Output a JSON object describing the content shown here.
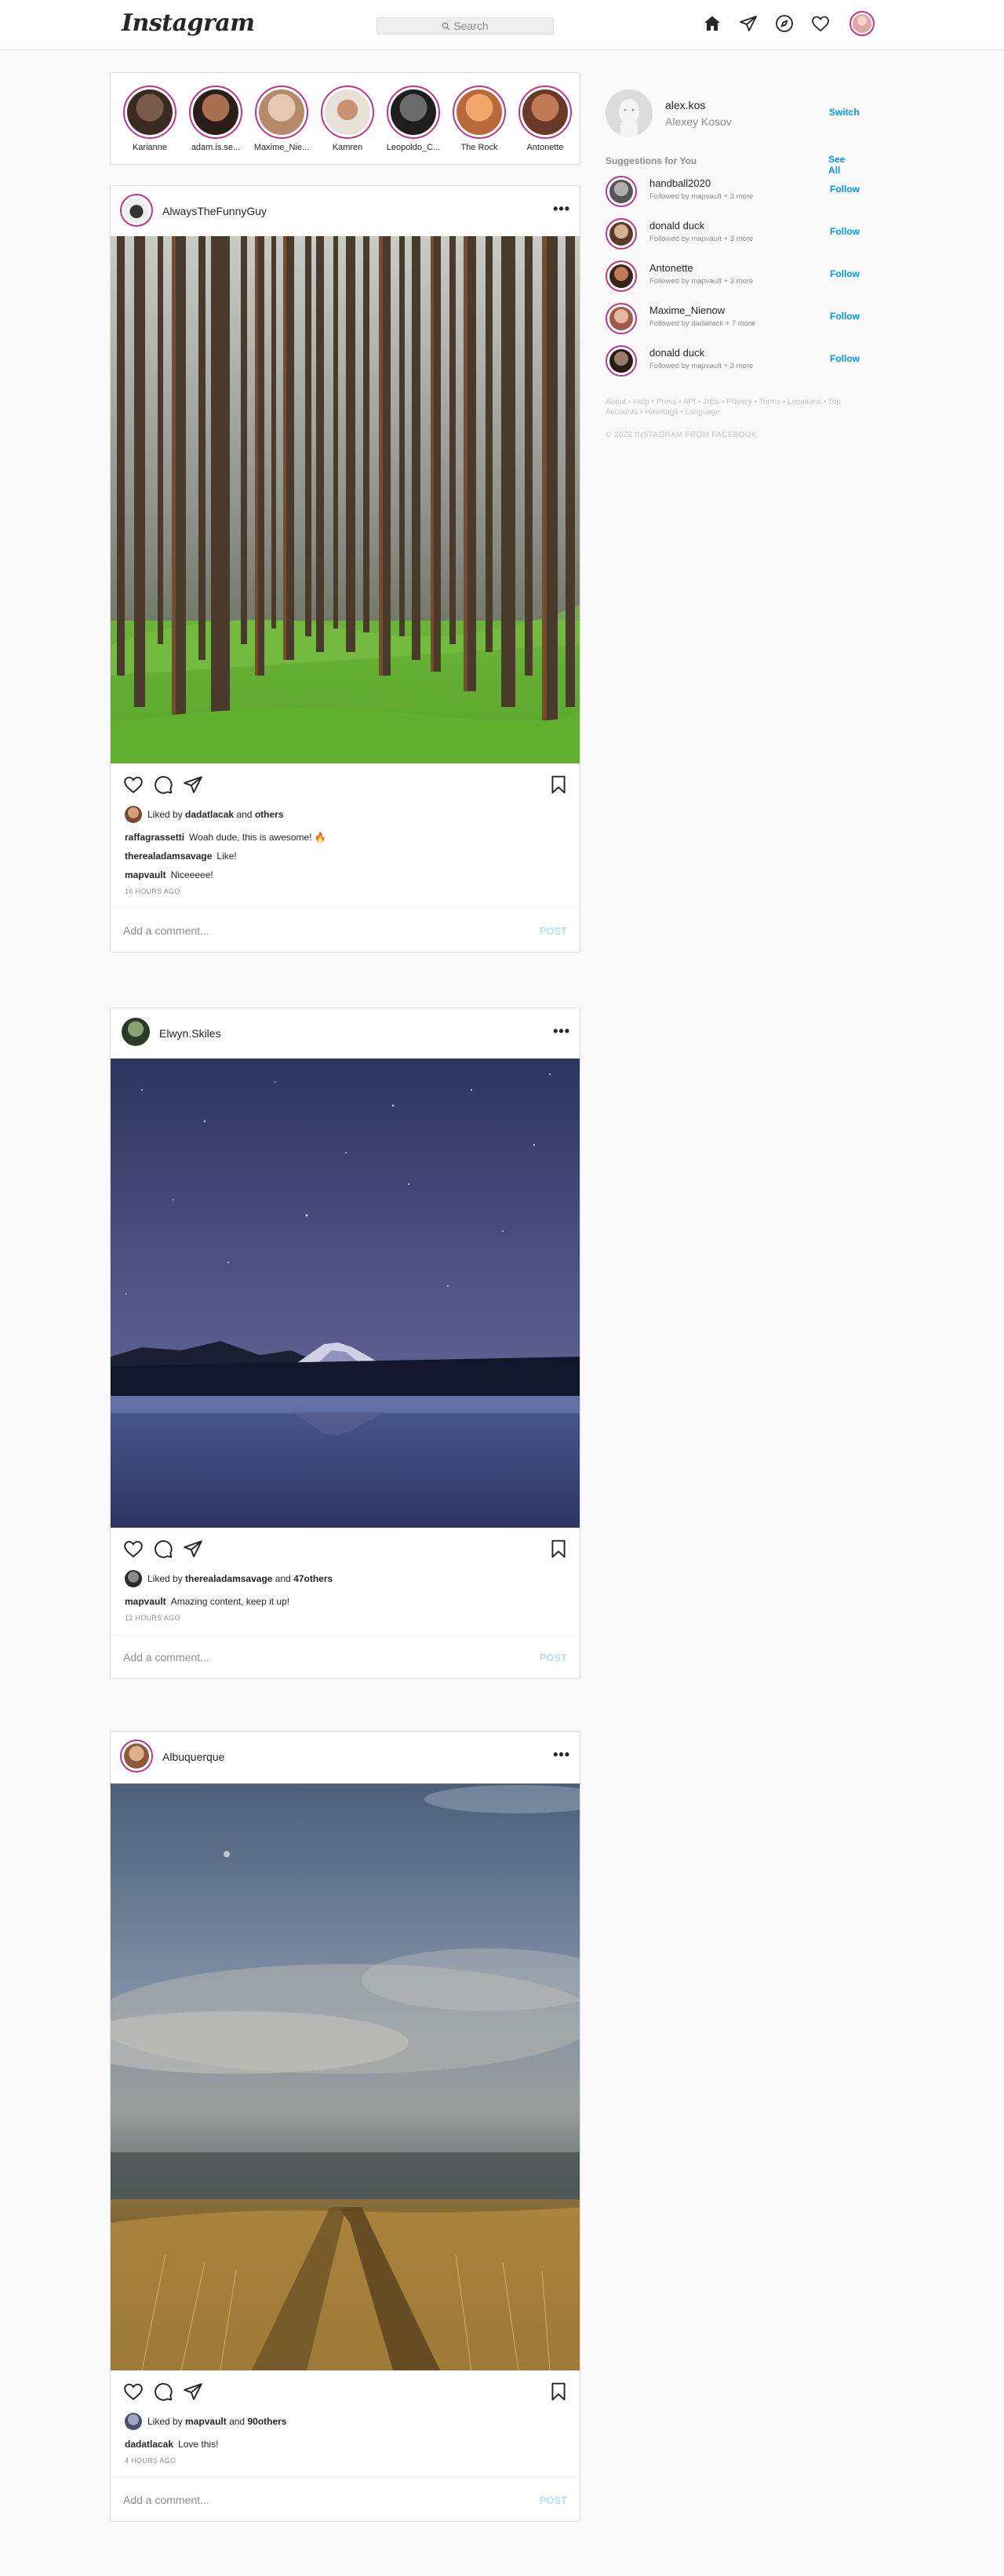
{
  "header": {
    "logo": "Instagram",
    "search_placeholder": "Search",
    "nav_icons": [
      "home-icon",
      "direct-icon",
      "explore-icon",
      "activity-heart-icon",
      "profile-avatar"
    ]
  },
  "stories": [
    {
      "name": "Karianne",
      "colors": [
        "#3a2a22",
        "#7a5a48"
      ]
    },
    {
      "name": "adam.is.se...",
      "colors": [
        "#2b1e18",
        "#a87050"
      ]
    },
    {
      "name": "Maxime_Nie...",
      "colors": [
        "#b48a6a",
        "#e6c7b1"
      ]
    },
    {
      "name": "Kamren",
      "colors": [
        "#e8e1d8",
        "#c79272"
      ]
    },
    {
      "name": "Leopoldo_C...",
      "colors": [
        "#1e1e1e",
        "#6b6b6b"
      ]
    },
    {
      "name": "The Rock",
      "colors": [
        "#f0a86a",
        "#b86a3a"
      ]
    },
    {
      "name": "Antonette",
      "colors": [
        "#6a3a28",
        "#c07a55"
      ]
    }
  ],
  "posts": [
    {
      "username": "AlwaysTheFunnyGuy",
      "liked_by": "dadatlacak",
      "liked_others": "others",
      "liked_prefix": "Liked by",
      "liked_and": "and",
      "comments": [
        {
          "user": "raffagrassetti",
          "text": "Woah dude, this is awesome! 🔥"
        },
        {
          "user": "therealadamsavage",
          "text": "Like!"
        },
        {
          "user": "mapvault",
          "text": "Niceeeee!"
        }
      ],
      "time": "16 HOURS AGO",
      "add_comment_placeholder": "Add a comment...",
      "post_label": "POST",
      "more": "•••"
    },
    {
      "username": "Elwyn.Skiles",
      "liked_by": "therealadamsavage",
      "liked_others": "47others",
      "liked_prefix": "Liked by",
      "liked_and": "and",
      "comments": [
        {
          "user": "mapvault",
          "text": "Amazing content, keep it up!"
        }
      ],
      "time": "12 HOURS AGO",
      "add_comment_placeholder": "Add a comment...",
      "post_label": "POST",
      "more": "•••"
    },
    {
      "username": "Albuquerque",
      "liked_by": "mapvault",
      "liked_others": "90others",
      "liked_prefix": "Liked by",
      "liked_and": "and",
      "comments": [
        {
          "user": "dadatlacak",
          "text": "Love this!"
        }
      ],
      "time": "4 HOURS AGO",
      "add_comment_placeholder": "Add a comment...",
      "post_label": "POST",
      "more": "•••"
    }
  ],
  "sidebar": {
    "username": "alex.kos",
    "full_name": "Alexey Kosov",
    "switch_label": "Switch",
    "suggestions_title": "Suggestions for You",
    "see_all": "See All",
    "follow_label": "Follow",
    "suggestions": [
      {
        "name": "handball2020",
        "sub": "Followed by mapvault + 3 more"
      },
      {
        "name": "donald duck",
        "sub": "Followed by mapvault + 3 more"
      },
      {
        "name": "Antonette",
        "sub": "Followed by mapvault + 3 more"
      },
      {
        "name": "Maxime_Nienow",
        "sub": "Followed by dadatlack + 7 more"
      },
      {
        "name": "donald duck",
        "sub": "Followed by mapvault + 3 more"
      }
    ],
    "footer_links": "About • Help • Press • API • Jobs • Privacy • Terms • Locations • Top Accounts • Hashtags • Language",
    "copyright": "© 2022 INSTAGRAM FROM FACEBOOK"
  },
  "colors": {
    "accent": "#0095f6",
    "story_ring": "#c13584",
    "border": "#dbdbdb",
    "background": "#fafafa"
  }
}
